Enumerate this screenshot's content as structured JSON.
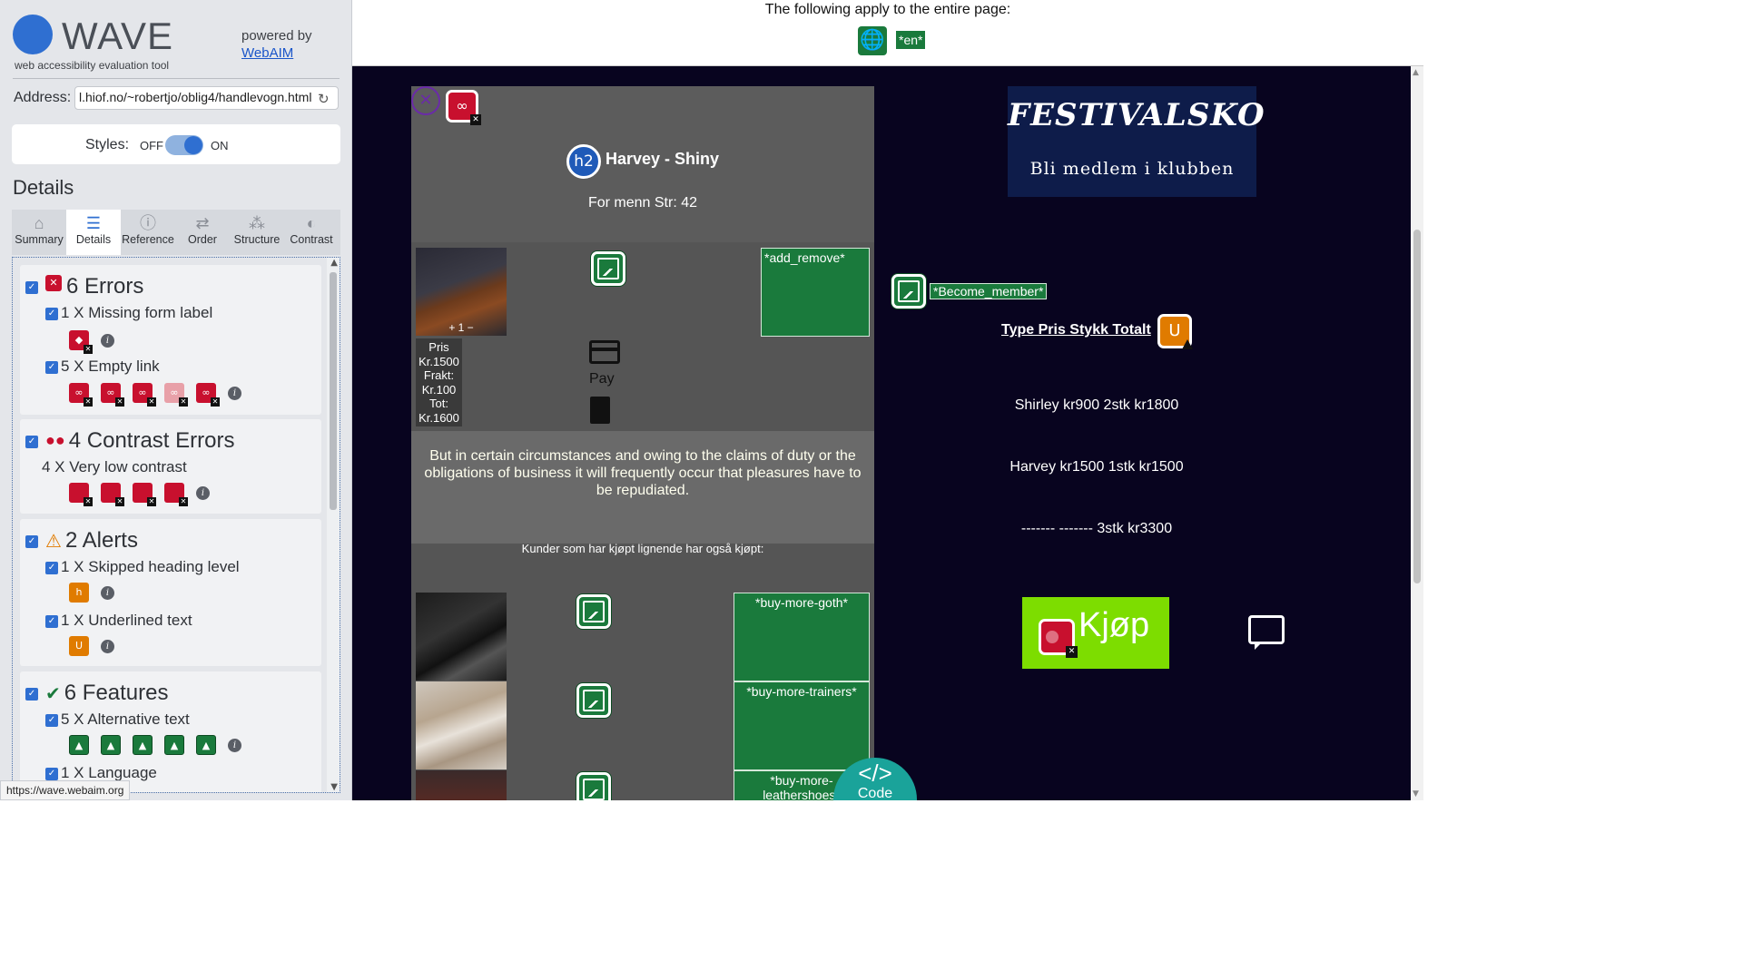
{
  "sidebar": {
    "logo_text": "WAVE",
    "tagline": "web accessibility evaluation tool",
    "powered_by": "powered by",
    "powered_link": "WebAIM",
    "address_label": "Address:",
    "address_value": "l.hiof.no/~robertjo/oblig4/handlevogn.html",
    "styles_label": "Styles:",
    "styles_off": "OFF",
    "styles_on": "ON",
    "styles_enabled": true,
    "details_heading": "Details",
    "tabs": [
      {
        "label": "Summary",
        "icon": "home-icon",
        "glyph": "⌂"
      },
      {
        "label": "Details",
        "icon": "list-icon",
        "glyph": "☰"
      },
      {
        "label": "Reference",
        "icon": "info-icon",
        "glyph": "ⓘ"
      },
      {
        "label": "Order",
        "icon": "order-icon",
        "glyph": "⇄"
      },
      {
        "label": "Structure",
        "icon": "structure-icon",
        "glyph": "⁂"
      },
      {
        "label": "Contrast",
        "icon": "contrast-icon",
        "glyph": "◐"
      }
    ],
    "active_tab": "Details",
    "groups": {
      "errors": {
        "title": "6 Errors",
        "items": [
          {
            "label": "1 X Missing form label"
          },
          {
            "label": "5 X Empty link"
          }
        ]
      },
      "contrast": {
        "title": "4 Contrast Errors",
        "items": [
          {
            "label": "4 X Very low contrast"
          }
        ]
      },
      "alerts": {
        "title": "2 Alerts",
        "items": [
          {
            "label": "1 X Skipped heading level"
          },
          {
            "label": "1 X Underlined text"
          }
        ]
      },
      "features": {
        "title": "6 Features",
        "items": [
          {
            "label": "5 X Alternative text"
          },
          {
            "label": "1 X Language"
          }
        ]
      }
    },
    "status_url": "https://wave.webaim.org"
  },
  "topbar": {
    "text": "The following apply to the entire page:",
    "lang_tag": "*en*"
  },
  "page": {
    "product": {
      "heading_badge": "h2",
      "name": "Harvey - Shiny",
      "subtitle": "For menn Str: 42",
      "qty": "+ 1 −",
      "price_lines": [
        "Pris",
        "Kr.1500",
        "Frakt:",
        "Kr.100",
        "Tot:",
        "Kr.1600"
      ],
      "add_remove": "*add_remove*",
      "apple_pay": "Pay",
      "description": "But in certain circumstances and owing to the claims of duty or the obligations of business it will frequently occur that pleasures have to be repudiated.",
      "also_bought": "Kunder som har kjøpt lignende har også kjøpt:",
      "upsell": [
        "*buy-more-goth*",
        "*buy-more-trainers*",
        "*buy-more-leathershoes*"
      ]
    },
    "festival": {
      "title": "FESTIVALSKO",
      "subtitle": "Bli medlem i klubben"
    },
    "become_member": "*Become_member*",
    "cart_header": "Type Pris Stykk Totalt",
    "underline_badge": "U",
    "cart_lines": [
      "Shirley kr900 2stk kr1800",
      "Harvey kr1500 1stk kr1500",
      "------- ------- 3stk kr3300"
    ],
    "buy_label": "Kjøp",
    "code_button": {
      "glyph": "</>",
      "label": "Code"
    }
  },
  "colors": {
    "error": "#c8102e",
    "alert": "#e07b00",
    "feature": "#1a7a3c",
    "accent": "#2f6fd1",
    "page_bg": "#08041f",
    "buy_green": "#7ddd00"
  }
}
